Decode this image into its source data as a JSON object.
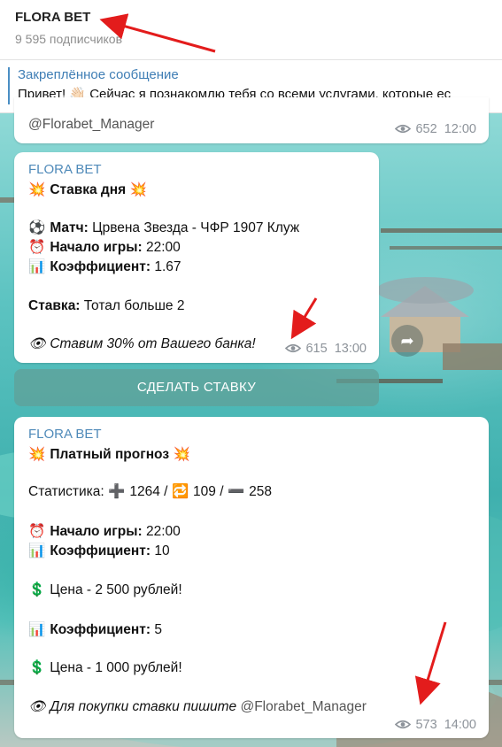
{
  "header": {
    "title": "FLORA BET",
    "subscribers": "9 595 подписчиков"
  },
  "pinned": {
    "title": "Закреплённое сообщение",
    "text": "Привет! 👋🏻 Сейчас я познакомлю тебя со всеми услугами, которые ес"
  },
  "post0": {
    "link": "@Florabet_Manager",
    "views": "652",
    "time": "12:00"
  },
  "post1": {
    "sender": "FLORA BET",
    "title_emoji_left": "💥",
    "title": "Ставка дня",
    "title_emoji_right": "💥",
    "match_icon": "⚽",
    "match_label": "Матч:",
    "match_value": " Црвена Звезда - ЧФР 1907 Клуж",
    "start_icon": "⏰",
    "start_label": "Начало игры:",
    "start_value": " 22:00",
    "coef_icon": "📊",
    "coef_label": "Коэффициент:",
    "coef_value": " 1.67",
    "bet_label": "Ставка:",
    "bet_value": " Тотал больше 2",
    "note_icon": "👁",
    "note": "Ставим 30% от Вашего банка!",
    "views": "615",
    "time": "13:00"
  },
  "cta_button": "СДЕЛАТЬ СТАВКУ",
  "post2": {
    "sender": "FLORA BET",
    "title_emoji_left": "💥",
    "title": "Платный прогноз",
    "title_emoji_right": "💥",
    "stats_label": "Статистика: ",
    "stats_win_icon": "➕",
    "stats_win": " 1264 / ",
    "stats_return_icon": "🔁",
    "stats_return": " 109 / ",
    "stats_loss_icon": "➖",
    "stats_loss": " 258",
    "start_icon": "⏰",
    "start_label": "Начало игры:",
    "start_value": " 22:00",
    "coef_icon": "📊",
    "coef_label": "Коэффициент:",
    "coef_value": " 10",
    "price1_icon": "💲",
    "price1": " Цена - 2 500 рублей!",
    "coef2_icon": "📊",
    "coef2_label": "Коэффициент:",
    "coef2_value": " 5",
    "price2_icon": "💲",
    "price2": " Цена - 1 000 рублей!",
    "note_icon": "👁",
    "note_text": "Для покупки ставки пишите ",
    "note_link": "@Florabet_Manager",
    "views": "573",
    "time": "14:00"
  },
  "icons": {
    "views": "eye-icon",
    "share": "share-icon",
    "annotation": "red-arrow"
  },
  "colors": {
    "sender": "#4f8ab9",
    "pinned_title": "#3f7eb5",
    "meta": "#8d939a",
    "arrow": "#e31c1c",
    "cta_bg": "#60a098"
  }
}
